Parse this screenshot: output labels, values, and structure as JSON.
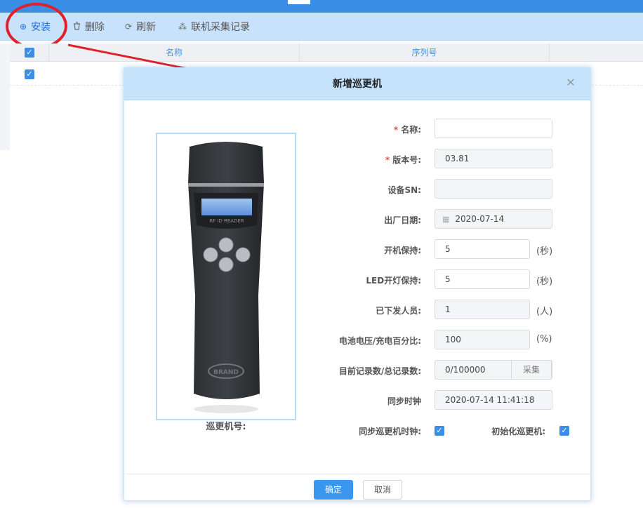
{
  "toolbar": {
    "install_label": "安装",
    "delete_label": "删除",
    "refresh_label": "刷新",
    "online_records_label": "联机采集记录"
  },
  "grid": {
    "columns": [
      "名称",
      "序列号"
    ]
  },
  "dialog": {
    "title": "新增巡更机",
    "device_caption": "巡更机号:",
    "device_screen_text": "RF ID READER",
    "device_brand": "BRAND",
    "fields": {
      "name_label": "名称:",
      "name_value": "",
      "version_label": "版本号:",
      "version_value": "03.81",
      "sn_label": "设备SN:",
      "sn_value": "",
      "factory_date_label": "出厂日期:",
      "factory_date_value": "2020-07-14",
      "power_hold_label": "开机保持:",
      "power_hold_value": "5",
      "power_hold_unit": "(秒)",
      "led_hold_label": "LED开灯保持:",
      "led_hold_value": "5",
      "led_hold_unit": "(秒)",
      "issued_staff_label": "已下发人员:",
      "issued_staff_value": "1",
      "issued_staff_unit": "(人)",
      "battery_label": "电池电压/充电百分比:",
      "battery_value": "100",
      "battery_unit": "(%)",
      "records_label": "目前记录数/总记录数:",
      "records_value": "0/100000",
      "collect_button": "采集",
      "sync_clock_label": "同步时钟",
      "sync_clock_value": "2020-07-14 11:41:18",
      "sync_device_clock_label": "同步巡更机时钟:",
      "init_device_label": "初始化巡更机:"
    },
    "ok_button": "确定",
    "cancel_button": "取消"
  },
  "colors": {
    "accent": "#3a8ee6",
    "annotation": "#e0202a"
  }
}
